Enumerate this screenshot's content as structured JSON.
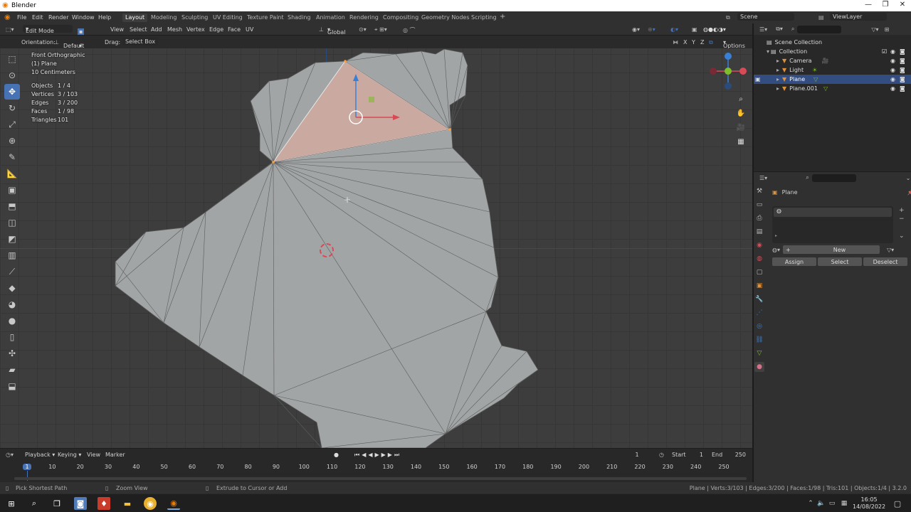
{
  "window": {
    "title": "Blender"
  },
  "menu": {
    "items": [
      "File",
      "Edit",
      "Render",
      "Window",
      "Help"
    ],
    "workspaces": [
      "Layout",
      "Modeling",
      "Sculpting",
      "UV Editing",
      "Texture Paint",
      "Shading",
      "Animation",
      "Rendering",
      "Compositing",
      "Geometry Nodes",
      "Scripting"
    ],
    "active_workspace": "Layout",
    "add_tab": "+",
    "scene": "Scene",
    "view_layer": "ViewLayer"
  },
  "viewport_header": {
    "mode": "Edit Mode",
    "menus": [
      "View",
      "Select",
      "Add",
      "Mesh",
      "Vertex",
      "Edge",
      "Face",
      "UV"
    ],
    "transform_orientation": "Global"
  },
  "tool_settings": {
    "orientation_label": "Orientation:",
    "orientation_value": "Default",
    "drag_label": "Drag:",
    "drag_value": "Select Box",
    "axes": [
      "X",
      "Y",
      "Z"
    ],
    "options": "Options"
  },
  "viewport_overlay": {
    "view_name": "Front Orthographic",
    "object": "(1) Plane",
    "scale": "10 Centimeters",
    "stats": [
      {
        "label": "Objects",
        "value": "1 / 4"
      },
      {
        "label": "Vertices",
        "value": "3 / 103"
      },
      {
        "label": "Edges",
        "value": "3 / 200"
      },
      {
        "label": "Faces",
        "value": "1 / 98"
      },
      {
        "label": "Triangles",
        "value": "101"
      }
    ]
  },
  "outliner": {
    "root": "Scene Collection",
    "collection": "Collection",
    "items": [
      {
        "name": "Camera",
        "selected": false,
        "color": "#e0923a"
      },
      {
        "name": "Light",
        "selected": false,
        "color": "#e0923a"
      },
      {
        "name": "Plane",
        "selected": true,
        "color": "#e0923a"
      },
      {
        "name": "Plane.001",
        "selected": false,
        "color": "#e0923a"
      }
    ]
  },
  "properties": {
    "object_name": "Plane",
    "new_button": "New",
    "assign": "Assign",
    "select": "Select",
    "deselect": "Deselect"
  },
  "timeline": {
    "menus": [
      "Playback",
      "Keying",
      "View",
      "Marker"
    ],
    "current_frame": "1",
    "start_label": "Start",
    "start": "1",
    "end_label": "End",
    "end": "250",
    "ruler": [
      "1",
      "10",
      "20",
      "30",
      "40",
      "50",
      "60",
      "70",
      "80",
      "90",
      "100",
      "110",
      "120",
      "130",
      "140",
      "150",
      "160",
      "170",
      "180",
      "190",
      "200",
      "210",
      "220",
      "230",
      "240",
      "250"
    ]
  },
  "statusbar": {
    "left": "Pick Shortest Path",
    "middle": "Zoom View",
    "right_hint": "Extrude to Cursor or Add",
    "info": "Plane | Verts:3/103 | Edges:3/200 | Faces:1/98 | Tris:101 | Objects:1/4 | 3.2.0"
  },
  "taskbar": {
    "time": "16:05",
    "date": "14/08/2022"
  },
  "colors": {
    "accent": "#4772b3",
    "selected_face": "#c9a9a0",
    "mesh": "#a2a5a6",
    "x_axis": "#d94a57",
    "y_axis": "#7fbd2c",
    "z_axis": "#3a7fd6"
  }
}
